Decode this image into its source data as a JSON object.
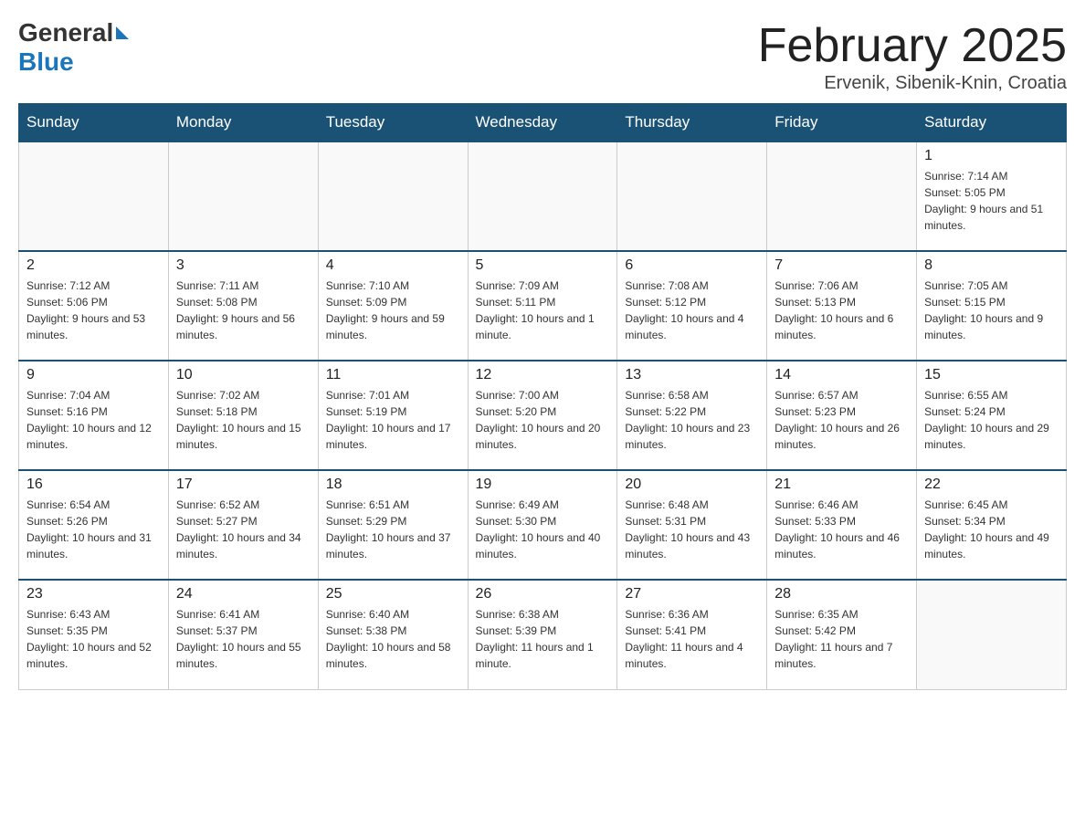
{
  "logo": {
    "general": "General",
    "blue": "Blue"
  },
  "title": "February 2025",
  "location": "Ervenik, Sibenik-Knin, Croatia",
  "days_of_week": [
    "Sunday",
    "Monday",
    "Tuesday",
    "Wednesday",
    "Thursday",
    "Friday",
    "Saturday"
  ],
  "weeks": [
    [
      {
        "day": "",
        "info": ""
      },
      {
        "day": "",
        "info": ""
      },
      {
        "day": "",
        "info": ""
      },
      {
        "day": "",
        "info": ""
      },
      {
        "day": "",
        "info": ""
      },
      {
        "day": "",
        "info": ""
      },
      {
        "day": "1",
        "info": "Sunrise: 7:14 AM\nSunset: 5:05 PM\nDaylight: 9 hours and 51 minutes."
      }
    ],
    [
      {
        "day": "2",
        "info": "Sunrise: 7:12 AM\nSunset: 5:06 PM\nDaylight: 9 hours and 53 minutes."
      },
      {
        "day": "3",
        "info": "Sunrise: 7:11 AM\nSunset: 5:08 PM\nDaylight: 9 hours and 56 minutes."
      },
      {
        "day": "4",
        "info": "Sunrise: 7:10 AM\nSunset: 5:09 PM\nDaylight: 9 hours and 59 minutes."
      },
      {
        "day": "5",
        "info": "Sunrise: 7:09 AM\nSunset: 5:11 PM\nDaylight: 10 hours and 1 minute."
      },
      {
        "day": "6",
        "info": "Sunrise: 7:08 AM\nSunset: 5:12 PM\nDaylight: 10 hours and 4 minutes."
      },
      {
        "day": "7",
        "info": "Sunrise: 7:06 AM\nSunset: 5:13 PM\nDaylight: 10 hours and 6 minutes."
      },
      {
        "day": "8",
        "info": "Sunrise: 7:05 AM\nSunset: 5:15 PM\nDaylight: 10 hours and 9 minutes."
      }
    ],
    [
      {
        "day": "9",
        "info": "Sunrise: 7:04 AM\nSunset: 5:16 PM\nDaylight: 10 hours and 12 minutes."
      },
      {
        "day": "10",
        "info": "Sunrise: 7:02 AM\nSunset: 5:18 PM\nDaylight: 10 hours and 15 minutes."
      },
      {
        "day": "11",
        "info": "Sunrise: 7:01 AM\nSunset: 5:19 PM\nDaylight: 10 hours and 17 minutes."
      },
      {
        "day": "12",
        "info": "Sunrise: 7:00 AM\nSunset: 5:20 PM\nDaylight: 10 hours and 20 minutes."
      },
      {
        "day": "13",
        "info": "Sunrise: 6:58 AM\nSunset: 5:22 PM\nDaylight: 10 hours and 23 minutes."
      },
      {
        "day": "14",
        "info": "Sunrise: 6:57 AM\nSunset: 5:23 PM\nDaylight: 10 hours and 26 minutes."
      },
      {
        "day": "15",
        "info": "Sunrise: 6:55 AM\nSunset: 5:24 PM\nDaylight: 10 hours and 29 minutes."
      }
    ],
    [
      {
        "day": "16",
        "info": "Sunrise: 6:54 AM\nSunset: 5:26 PM\nDaylight: 10 hours and 31 minutes."
      },
      {
        "day": "17",
        "info": "Sunrise: 6:52 AM\nSunset: 5:27 PM\nDaylight: 10 hours and 34 minutes."
      },
      {
        "day": "18",
        "info": "Sunrise: 6:51 AM\nSunset: 5:29 PM\nDaylight: 10 hours and 37 minutes."
      },
      {
        "day": "19",
        "info": "Sunrise: 6:49 AM\nSunset: 5:30 PM\nDaylight: 10 hours and 40 minutes."
      },
      {
        "day": "20",
        "info": "Sunrise: 6:48 AM\nSunset: 5:31 PM\nDaylight: 10 hours and 43 minutes."
      },
      {
        "day": "21",
        "info": "Sunrise: 6:46 AM\nSunset: 5:33 PM\nDaylight: 10 hours and 46 minutes."
      },
      {
        "day": "22",
        "info": "Sunrise: 6:45 AM\nSunset: 5:34 PM\nDaylight: 10 hours and 49 minutes."
      }
    ],
    [
      {
        "day": "23",
        "info": "Sunrise: 6:43 AM\nSunset: 5:35 PM\nDaylight: 10 hours and 52 minutes."
      },
      {
        "day": "24",
        "info": "Sunrise: 6:41 AM\nSunset: 5:37 PM\nDaylight: 10 hours and 55 minutes."
      },
      {
        "day": "25",
        "info": "Sunrise: 6:40 AM\nSunset: 5:38 PM\nDaylight: 10 hours and 58 minutes."
      },
      {
        "day": "26",
        "info": "Sunrise: 6:38 AM\nSunset: 5:39 PM\nDaylight: 11 hours and 1 minute."
      },
      {
        "day": "27",
        "info": "Sunrise: 6:36 AM\nSunset: 5:41 PM\nDaylight: 11 hours and 4 minutes."
      },
      {
        "day": "28",
        "info": "Sunrise: 6:35 AM\nSunset: 5:42 PM\nDaylight: 11 hours and 7 minutes."
      },
      {
        "day": "",
        "info": ""
      }
    ]
  ]
}
